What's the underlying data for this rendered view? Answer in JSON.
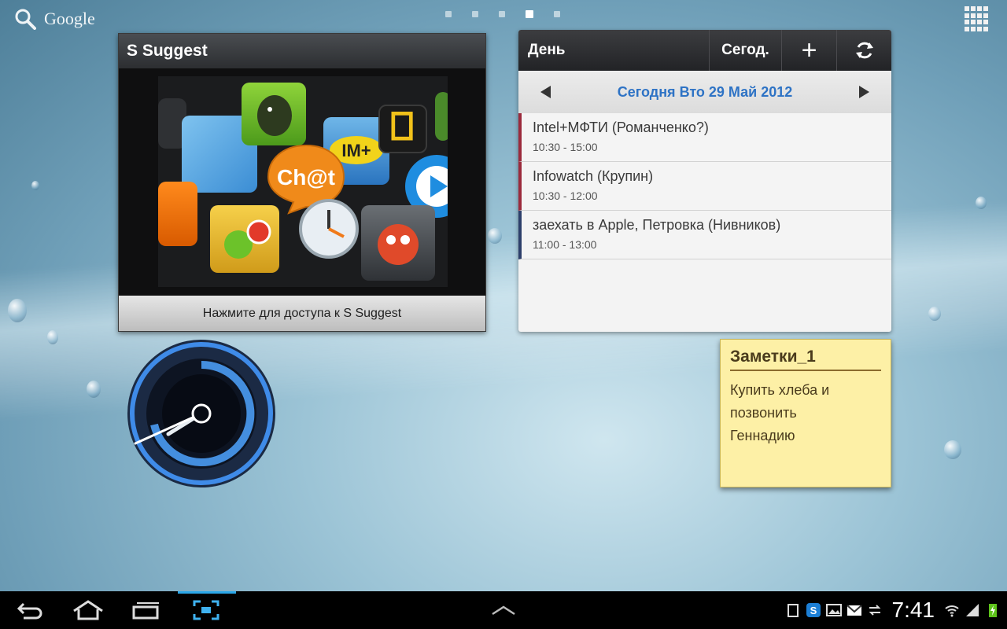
{
  "top_bar": {
    "search_label": "Google",
    "page_count": 5,
    "active_page": 4
  },
  "suggest_widget": {
    "title": "S Suggest",
    "footer": "Нажмите для доступа к S Suggest",
    "app_tiles": [
      "chat-app-icon",
      "evernote-icon",
      "natgeo-tv-icon",
      "cut-the-rope-icon",
      "alarm-clock-icon",
      "mission-all-in-one-icon",
      "bubbles-game-icon",
      "soundhound-icon",
      "im-plus-icon",
      "video-player-icon"
    ]
  },
  "calendar_widget": {
    "day_label": "День",
    "today_label": "Сегод.",
    "add_label": "+",
    "date": "Сегодня Вто 29 Май 2012",
    "events": [
      {
        "name": "Intel+МФТИ (Романченко?)",
        "time": "10:30 - 15:00"
      },
      {
        "name": "Infowatch (Крупин)",
        "time": "10:30 - 12:00"
      },
      {
        "name": "заехать в Apple, Петровка (Нивников)",
        "time": "11:00 - 13:00"
      }
    ]
  },
  "notes_widget": {
    "title": "Заметки_1",
    "text_lines": [
      "Купить хлеба и",
      "позвонить",
      "Геннадию"
    ]
  },
  "status_bar": {
    "time": "7:41",
    "accent_color": "#2aa7e8"
  }
}
